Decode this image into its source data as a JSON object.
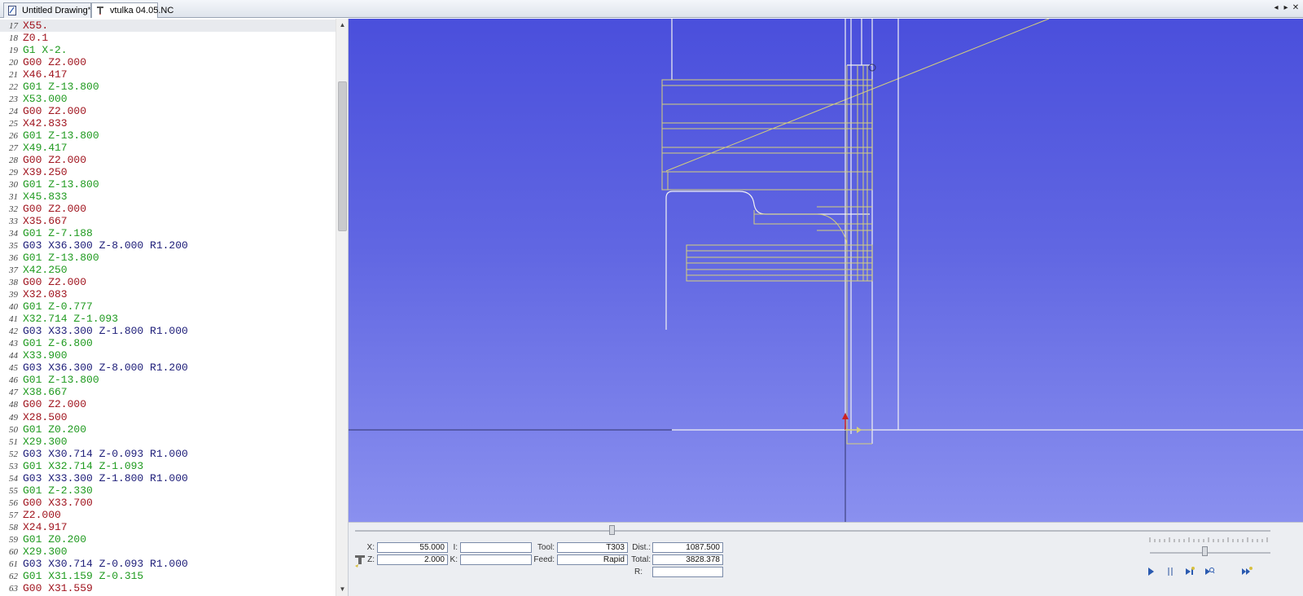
{
  "tabs": [
    {
      "label": "Untitled Drawing",
      "modified_mark": "*",
      "icon": "drawing-icon"
    },
    {
      "label": "vtulka 04.05.NC",
      "icon": "lathe-tool-icon"
    }
  ],
  "tab_nav": {
    "prev": "◂",
    "next": "▸",
    "close": "✕"
  },
  "code": [
    {
      "n": "17",
      "parts": [
        {
          "t": "X55.",
          "c": "red"
        }
      ]
    },
    {
      "n": "18",
      "parts": [
        {
          "t": "Z0.1",
          "c": "red"
        }
      ]
    },
    {
      "n": "19",
      "parts": [
        {
          "t": "G1 X-2.",
          "c": "green"
        }
      ]
    },
    {
      "n": "20",
      "parts": [
        {
          "t": "G00 Z2.000",
          "c": "red"
        }
      ]
    },
    {
      "n": "21",
      "parts": [
        {
          "t": "X46.417",
          "c": "red"
        }
      ]
    },
    {
      "n": "22",
      "parts": [
        {
          "t": "G01 Z-13.800",
          "c": "green"
        }
      ]
    },
    {
      "n": "23",
      "parts": [
        {
          "t": "X53.000",
          "c": "green"
        }
      ]
    },
    {
      "n": "24",
      "parts": [
        {
          "t": "G00 Z2.000",
          "c": "red"
        }
      ]
    },
    {
      "n": "25",
      "parts": [
        {
          "t": "X42.833",
          "c": "red"
        }
      ]
    },
    {
      "n": "26",
      "parts": [
        {
          "t": "G01 Z-13.800",
          "c": "green"
        }
      ]
    },
    {
      "n": "27",
      "parts": [
        {
          "t": "X49.417",
          "c": "green"
        }
      ]
    },
    {
      "n": "28",
      "parts": [
        {
          "t": "G00 Z2.000",
          "c": "red"
        }
      ]
    },
    {
      "n": "29",
      "parts": [
        {
          "t": "X39.250",
          "c": "red"
        }
      ]
    },
    {
      "n": "30",
      "parts": [
        {
          "t": "G01 Z-13.800",
          "c": "green"
        }
      ]
    },
    {
      "n": "31",
      "parts": [
        {
          "t": "X45.833",
          "c": "green"
        }
      ]
    },
    {
      "n": "32",
      "parts": [
        {
          "t": "G00 Z2.000",
          "c": "red"
        }
      ]
    },
    {
      "n": "33",
      "parts": [
        {
          "t": "X35.667",
          "c": "red"
        }
      ]
    },
    {
      "n": "34",
      "parts": [
        {
          "t": "G01 Z-7.188",
          "c": "green"
        }
      ]
    },
    {
      "n": "35",
      "parts": [
        {
          "t": "G03 X36.300 Z-8.000 R1.200",
          "c": "blue"
        }
      ]
    },
    {
      "n": "36",
      "parts": [
        {
          "t": "G01 Z-13.800",
          "c": "green"
        }
      ]
    },
    {
      "n": "37",
      "parts": [
        {
          "t": "X42.250",
          "c": "green"
        }
      ]
    },
    {
      "n": "38",
      "parts": [
        {
          "t": "G00 Z2.000",
          "c": "red"
        }
      ]
    },
    {
      "n": "39",
      "parts": [
        {
          "t": "X32.083",
          "c": "red"
        }
      ]
    },
    {
      "n": "40",
      "parts": [
        {
          "t": "G01 Z-0.777",
          "c": "green"
        }
      ]
    },
    {
      "n": "41",
      "parts": [
        {
          "t": "X32.714 Z-1.093",
          "c": "green"
        }
      ]
    },
    {
      "n": "42",
      "parts": [
        {
          "t": "G03 X33.300 Z-1.800 R1.000",
          "c": "blue"
        }
      ]
    },
    {
      "n": "43",
      "parts": [
        {
          "t": "G01 Z-6.800",
          "c": "green"
        }
      ]
    },
    {
      "n": "44",
      "parts": [
        {
          "t": "X33.900",
          "c": "green"
        }
      ]
    },
    {
      "n": "45",
      "parts": [
        {
          "t": "G03 X36.300 Z-8.000 R1.200",
          "c": "blue"
        }
      ]
    },
    {
      "n": "46",
      "parts": [
        {
          "t": "G01 Z-13.800",
          "c": "green"
        }
      ]
    },
    {
      "n": "47",
      "parts": [
        {
          "t": "X38.667",
          "c": "green"
        }
      ]
    },
    {
      "n": "48",
      "parts": [
        {
          "t": "G00 Z2.000",
          "c": "red"
        }
      ]
    },
    {
      "n": "49",
      "parts": [
        {
          "t": "X28.500",
          "c": "red"
        }
      ]
    },
    {
      "n": "50",
      "parts": [
        {
          "t": "G01 Z0.200",
          "c": "green"
        }
      ]
    },
    {
      "n": "51",
      "parts": [
        {
          "t": "X29.300",
          "c": "green"
        }
      ]
    },
    {
      "n": "52",
      "parts": [
        {
          "t": "G03 X30.714 Z-0.093 R1.000",
          "c": "blue"
        }
      ]
    },
    {
      "n": "53",
      "parts": [
        {
          "t": "G01 X32.714 Z-1.093",
          "c": "green"
        }
      ]
    },
    {
      "n": "54",
      "parts": [
        {
          "t": "G03 X33.300 Z-1.800 R1.000",
          "c": "blue"
        }
      ]
    },
    {
      "n": "55",
      "parts": [
        {
          "t": "G01 Z-2.330",
          "c": "green"
        }
      ]
    },
    {
      "n": "56",
      "parts": [
        {
          "t": "G00 X33.700",
          "c": "red"
        }
      ]
    },
    {
      "n": "57",
      "parts": [
        {
          "t": "Z2.000",
          "c": "red"
        }
      ]
    },
    {
      "n": "58",
      "parts": [
        {
          "t": "X24.917",
          "c": "red"
        }
      ]
    },
    {
      "n": "59",
      "parts": [
        {
          "t": "G01 Z0.200",
          "c": "green"
        }
      ]
    },
    {
      "n": "60",
      "parts": [
        {
          "t": "X29.300",
          "c": "green"
        }
      ]
    },
    {
      "n": "61",
      "parts": [
        {
          "t": "G03 X30.714 Z-0.093 R1.000",
          "c": "blue"
        }
      ]
    },
    {
      "n": "62",
      "parts": [
        {
          "t": "G01 X31.159 Z-0.315",
          "c": "green"
        }
      ]
    },
    {
      "n": "63",
      "parts": [
        {
          "t": "G00 X31.559",
          "c": "red"
        }
      ]
    }
  ],
  "code_colors": {
    "red": "#a0141e",
    "green": "#1f9a1f",
    "blue": "#1c1c78"
  },
  "scroll": {
    "up": "▲",
    "down": "▼"
  },
  "fields": {
    "x_label": "X:",
    "x_value": "55.000",
    "z_label": "Z:",
    "z_value": "2.000",
    "i_label": "I:",
    "i_value": "",
    "k_label": "K:",
    "k_value": "",
    "tool_label": "Tool:",
    "tool_value": "T303",
    "feed_label": "Feed:",
    "feed_value": "Rapid",
    "dist_label": "Dist.:",
    "dist_value": "1087.500",
    "total_label": "Total:",
    "total_value": "3828.378",
    "r_label": "R:",
    "r_value": ""
  },
  "playback": {
    "buttons": [
      "play-icon",
      "pause-icon",
      "step-icon",
      "step-zoom-icon",
      "fast-forward-icon"
    ]
  },
  "colors": {
    "toolpath": "#d6d07a",
    "geometry": "#f2f2f2",
    "viewport_top": "#4a4fdc",
    "viewport_bottom": "#8a90ef"
  }
}
